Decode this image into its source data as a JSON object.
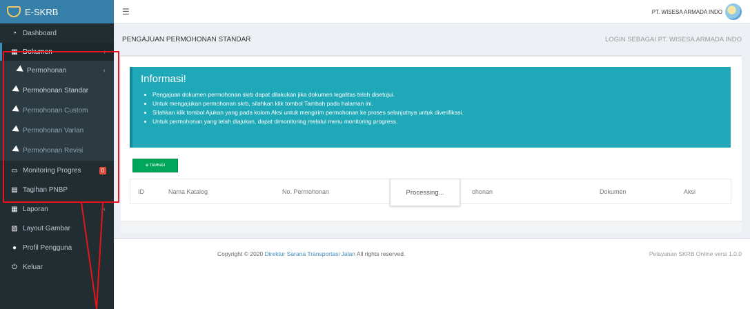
{
  "app": {
    "brand": "E-SKRB"
  },
  "sidebar": {
    "items": [
      {
        "label": "Dashboard"
      },
      {
        "label": "Dokumen"
      },
      {
        "label": "Permohonan"
      },
      {
        "label": "Permohonan Standar"
      },
      {
        "label": "Permohonan Custom"
      },
      {
        "label": "Permohonan Varian"
      },
      {
        "label": "Permohonan Revisi"
      },
      {
        "label": "Monitoring Progres",
        "badge": "0"
      },
      {
        "label": "Tagihan PNBP"
      },
      {
        "label": "Laporan"
      },
      {
        "label": "Layout Gambar"
      },
      {
        "label": "Profil Pengguna"
      },
      {
        "label": "Keluar"
      }
    ]
  },
  "topbar": {
    "user": "PT. WISESA ARMADA INDO"
  },
  "header": {
    "title": "PENGAJUAN PERMOHONAN STANDAR",
    "login_as": "LOGIN SEBAGAI PT. WISESA ARMADA INDO"
  },
  "info": {
    "title": "Informasi!",
    "items": [
      "Pengajuan dokumen permohonan skrb dapat dilakukan jika dokumen legalitas telah disetujui.",
      "Untuk mengajukan permohonan skrb, silahkan klik tombol Tambah pada halaman ini.",
      "Silahkan klik tombol Ajukan yang pada kolom Aksi untuk mengirim permohonan ke proses selanjutnya untuk diverifikasi.",
      "Untuk permohonan yang telah diajukan, dapat dimonitoring melalui menu monitoring progress."
    ]
  },
  "actions": {
    "tambah": "⊕ TAMBAH"
  },
  "table": {
    "columns": [
      "ID",
      "Nama Katalog",
      "No. Permohonan",
      "ohonan",
      "Dokumen",
      "Aksi"
    ],
    "processing": "Processing..."
  },
  "footer": {
    "copyright_prefix": "Copyright © 2020",
    "copyright_link": "Direktur Sarana Transportasi Jalan",
    "copyright_suffix": "All rights reserved.",
    "version": "Pelayanan SKRB Online versi 1.0.0"
  },
  "colors": {
    "sidebar_bg": "#222d32",
    "brand_bg": "#367fa9",
    "callout_bg": "#1fa8b8",
    "button_green": "#00a65a",
    "badge_red": "#dd4b39",
    "annotation_red": "#e8141a"
  },
  "icons": {
    "dashboard": "tachometer-icon",
    "dokumen": "grid-icon",
    "permohonan": "paper-plane-icon",
    "monitoring": "monitor-icon",
    "tagihan": "document-icon",
    "laporan": "grid-icon",
    "layout": "image-icon",
    "profil": "user-icon",
    "keluar": "power-icon"
  }
}
